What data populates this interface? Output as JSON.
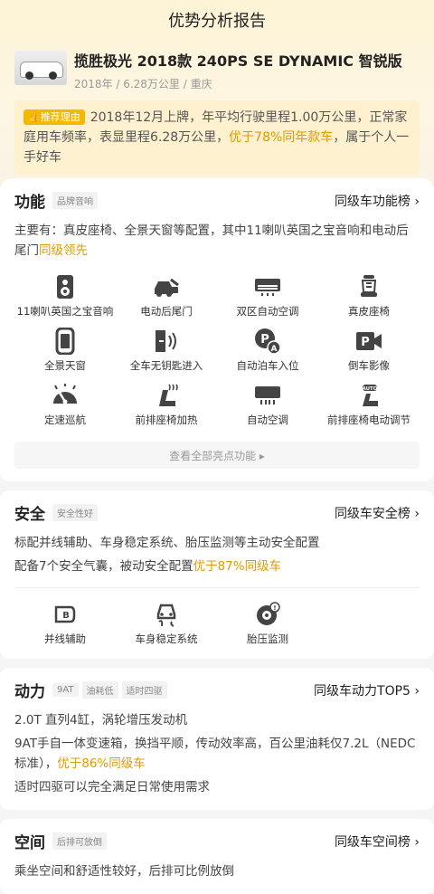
{
  "header": {
    "title": "优势分析报告"
  },
  "car": {
    "name": "揽胜极光 2018款 240PS SE DYNAMIC 智锐版",
    "meta": "2018年 / 6.28万公里 / 重庆"
  },
  "reason": {
    "tag": "推荐理由",
    "text1": "2018年12月上牌，年平均行驶里程1.00万公里，正常家庭用车频率，表显里程6.28万公里，",
    "highlight": "优于78%同年款车",
    "text2": "，属于个人一手好车"
  },
  "function": {
    "title": "功能",
    "chip": "品牌音响",
    "link": "同级车功能榜 ›",
    "text": "主要有：真皮座椅、全景天窗等配置，其中11喇叭英国之宝音响和电动后尾门",
    "highlight": "同级领先",
    "features": [
      {
        "label": "11喇叭英国之宝音响",
        "icon": "speaker-icon"
      },
      {
        "label": "电动后尾门",
        "icon": "tailgate-icon"
      },
      {
        "label": "双区自动空调",
        "icon": "ac-icon"
      },
      {
        "label": "真皮座椅",
        "icon": "seat-icon"
      },
      {
        "label": "全景天窗",
        "icon": "sunroof-icon"
      },
      {
        "label": "全车无钥匙进入",
        "icon": "keyless-icon"
      },
      {
        "label": "自动泊车入位",
        "icon": "auto-park-icon"
      },
      {
        "label": "倒车影像",
        "icon": "rear-camera-icon"
      },
      {
        "label": "定速巡航",
        "icon": "cruise-icon"
      },
      {
        "label": "前排座椅加热",
        "icon": "seat-heat-icon"
      },
      {
        "label": "自动空调",
        "icon": "auto-ac-icon"
      },
      {
        "label": "前排座椅电动调节",
        "icon": "seat-adjust-icon"
      }
    ],
    "view_all": "查看全部亮点功能 ▸"
  },
  "safety": {
    "title": "安全",
    "chip": "安全性好",
    "link": "同级车安全榜 ›",
    "text1": "标配并线辅助、车身稳定系统、胎压监测等主动安全配置",
    "text2a": "配备7个安全气囊，被动安全配置",
    "highlight": "优于87%同级车",
    "features": [
      {
        "label": "并线辅助",
        "icon": "lane-assist-icon"
      },
      {
        "label": "车身稳定系统",
        "icon": "stability-icon"
      },
      {
        "label": "胎压监测",
        "icon": "tire-pressure-icon"
      }
    ]
  },
  "power": {
    "title": "动力",
    "chips": [
      "9AT",
      "油耗低",
      "适时四驱"
    ],
    "link": "同级车动力TOP5 ›",
    "line1": "2.0T 直列4缸，涡轮增压发动机",
    "line2a": "9AT手自一体变速箱，换挡平顺，传动效率高，百公里油耗仅7.2L（NEDC标准），",
    "highlight": "优于86%同级车",
    "line3": "适时四驱可以完全满足日常使用需求"
  },
  "space": {
    "title": "空间",
    "chip": "后排可放倒",
    "link": "同级车空间榜 ›",
    "text": "乘坐空间和舒适性较好，后排可比例放倒"
  },
  "colors": {
    "accent": "#e09a00",
    "tag": "#f5b800",
    "icon": "#444444"
  }
}
